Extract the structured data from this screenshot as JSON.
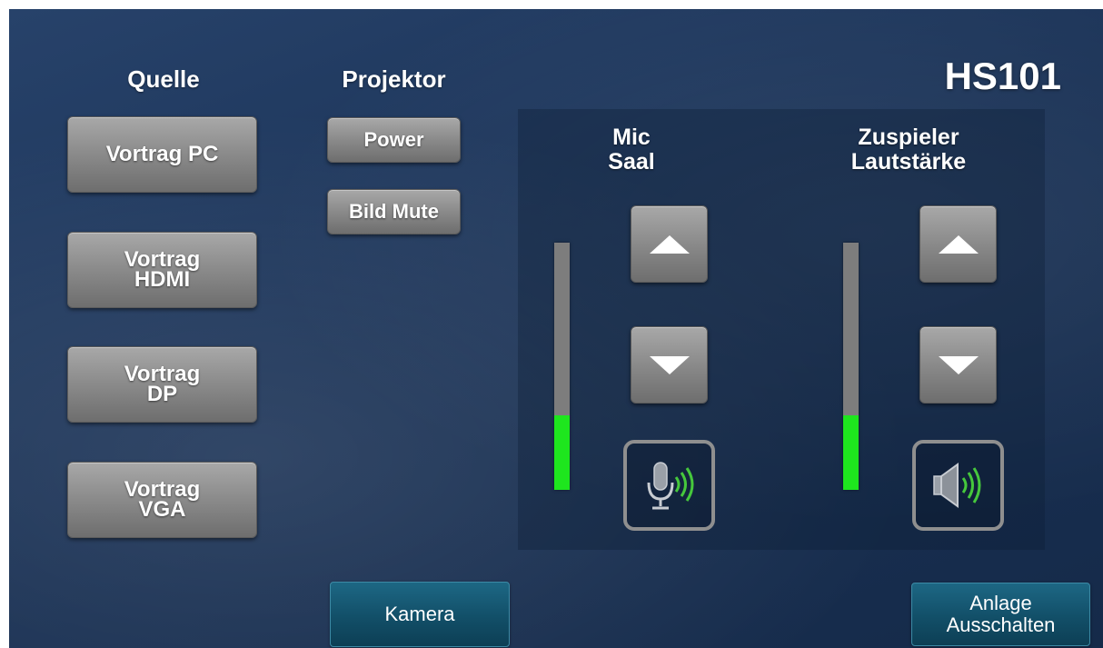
{
  "title": "HS101",
  "headings": {
    "source": "Quelle",
    "projector": "Projektor",
    "mic": "Mic\nSaal",
    "player": "Zuspieler\nLautstärke"
  },
  "source_buttons": [
    {
      "label": "Vortrag  PC"
    },
    {
      "label": "Vortrag\nHDMI"
    },
    {
      "label": "Vortrag\nDP"
    },
    {
      "label": "Vortrag\nVGA"
    }
  ],
  "projector_buttons": {
    "power": "Power",
    "picture_mute": "Bild  Mute"
  },
  "mic": {
    "level_fraction": 0.3,
    "up_icon": "triangle-up-icon",
    "down_icon": "triangle-down-icon",
    "mute_icon": "microphone-icon"
  },
  "player": {
    "level_fraction": 0.3,
    "up_icon": "triangle-up-icon",
    "down_icon": "triangle-down-icon",
    "mute_icon": "speaker-icon"
  },
  "bottom": {
    "camera": "Kamera",
    "shutdown": "Anlage\nAusschalten"
  },
  "colors": {
    "level_green": "#1ee61e",
    "icon_green": "#46c83c",
    "teal_button": "#124f68"
  }
}
